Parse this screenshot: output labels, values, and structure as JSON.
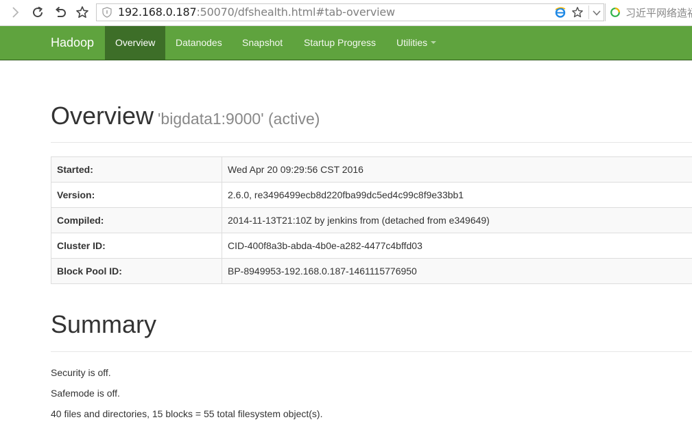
{
  "browser": {
    "url_host": "192.168.0.187",
    "url_rest": ":50070/dfshealth.html#tab-overview",
    "search_text": "习近平网络造福"
  },
  "navbar": {
    "brand": "Hadoop",
    "items": [
      {
        "label": "Overview",
        "active": true
      },
      {
        "label": "Datanodes"
      },
      {
        "label": "Snapshot"
      },
      {
        "label": "Startup Progress"
      },
      {
        "label": "Utilities"
      }
    ]
  },
  "overview": {
    "title": "Overview",
    "subtitle": "'bigdata1:9000' (active)",
    "rows": [
      {
        "label": "Started:",
        "value": "Wed Apr 20 09:29:56 CST 2016"
      },
      {
        "label": "Version:",
        "value": "2.6.0, re3496499ecb8d220fba99dc5ed4c99c8f9e33bb1"
      },
      {
        "label": "Compiled:",
        "value": "2014-11-13T21:10Z by jenkins from (detached from e349649)"
      },
      {
        "label": "Cluster ID:",
        "value": "CID-400f8a3b-abda-4b0e-a282-4477c4bffd03"
      },
      {
        "label": "Block Pool ID:",
        "value": "BP-8949953-192.168.0.187-1461115776950"
      }
    ]
  },
  "summary": {
    "title": "Summary",
    "security": "Security is off.",
    "safemode": "Safemode is off.",
    "files": "40 files and directories, 15 blocks = 55 total filesystem object(s)."
  },
  "colors": {
    "navbar": "#5fa33e",
    "navbar_active": "#3d6e28"
  }
}
